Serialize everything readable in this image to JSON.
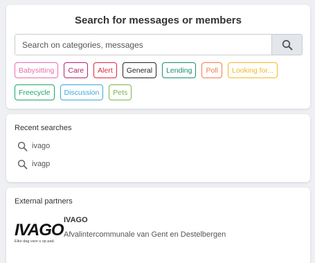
{
  "search": {
    "title": "Search for messages or members",
    "placeholder": "Search on categories, messages",
    "button_icon": "search-icon",
    "tags": [
      {
        "label": "Babysitting",
        "color": "#e86cb0"
      },
      {
        "label": "Care",
        "color": "#b2226e"
      },
      {
        "label": "Alert",
        "color": "#d9283d"
      },
      {
        "label": "General",
        "color": "#222222"
      },
      {
        "label": "Lending",
        "color": "#1e8c6e"
      },
      {
        "label": "Poll",
        "color": "#f07a4b"
      },
      {
        "label": "Looking for...",
        "color": "#f0b92a"
      },
      {
        "label": "Freecycle",
        "color": "#19a76c"
      },
      {
        "label": "Discussion",
        "color": "#3aa7dc"
      },
      {
        "label": "Pets",
        "color": "#7ab648"
      }
    ]
  },
  "recent": {
    "label": "Recent searches",
    "items": [
      {
        "text": "ivago",
        "icon": "search-icon"
      },
      {
        "text": "ivagp",
        "icon": "search-icon"
      }
    ]
  },
  "partners": {
    "label": "External partners",
    "items": [
      {
        "logo_text": "IVAGO",
        "logo_tagline": "Elke dag vanr u op pad.",
        "name": "IVAGO",
        "description": "Afvalintercommunale van Gent en Destelbergen"
      }
    ]
  }
}
